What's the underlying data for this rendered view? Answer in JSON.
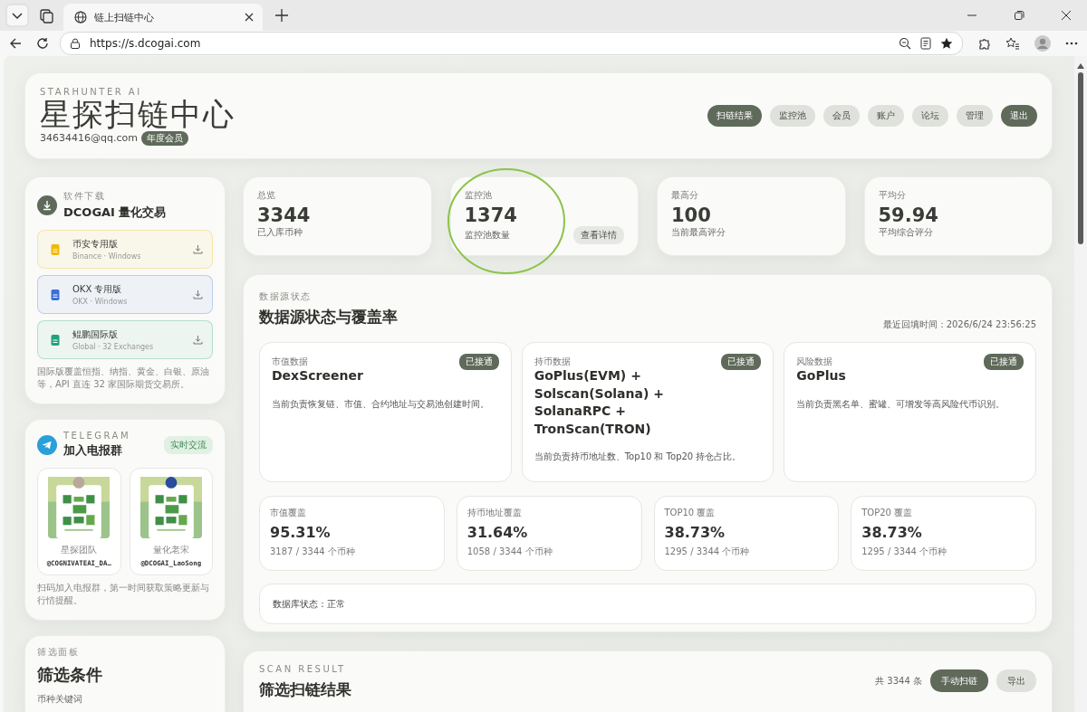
{
  "browser": {
    "tab_title": "链上扫链中心",
    "url": "https://s.dcogai.com"
  },
  "header": {
    "eyebrow": "STARHUNTER AI",
    "title": "星探扫链中心",
    "email": "34634416@qq.com",
    "badge": "年度会员",
    "nav": [
      {
        "label": "扫链结果",
        "selected": true
      },
      {
        "label": "监控池",
        "selected": false
      },
      {
        "label": "会员",
        "selected": false
      },
      {
        "label": "账户",
        "selected": false
      },
      {
        "label": "论坛",
        "selected": false
      },
      {
        "label": "管理",
        "selected": false
      }
    ],
    "logout": "退出"
  },
  "download": {
    "eyebrow": "软件下载",
    "title": "DCOGAI 量化交易",
    "items": [
      {
        "name": "币安专用版",
        "sub": "Binance · Windows",
        "color": "#f0b90b"
      },
      {
        "name": "OKX 专用版",
        "sub": "OKX · Windows",
        "color": "#3b6fd8"
      },
      {
        "name": "鲲鹏国际版",
        "sub": "Global · 32 Exchanges",
        "color": "#1fa37a"
      }
    ],
    "note": "国际版覆盖恒指、纳指、黄金、白银、原油等，API 直连 32 家国际期货交易所。"
  },
  "telegram": {
    "eyebrow": "TELEGRAM",
    "title": "加入电报群",
    "tag": "实时交流",
    "groups": [
      {
        "kind": "picture",
        "label": "星探团队",
        "handle": "@COGNIVATEAI_DA…"
      },
      {
        "kind": "picture",
        "label": "量化老宋",
        "handle": "@DCOGAI_LaoSong"
      }
    ],
    "note": "扫码加入电报群，第一时间获取策略更新与行情提醒。"
  },
  "filter": {
    "eyebrow": "筛选面板",
    "title": "筛选条件",
    "field_label": "币种关键词"
  },
  "stats": [
    {
      "label": "总览",
      "value": "3344",
      "sub": "已入库币种"
    },
    {
      "label": "监控池",
      "value": "1374",
      "sub": "监控池数量",
      "action": "查看详情"
    },
    {
      "label": "最高分",
      "value": "100",
      "sub": "当前最高评分"
    },
    {
      "label": "平均分",
      "value": "59.94",
      "sub": "平均综合评分"
    }
  ],
  "annotation": {
    "kind": "circle"
  },
  "sources": {
    "eyebrow": "数据源状态",
    "title": "数据源状态与覆盖率",
    "updated": "最近回填时间：2026/6/24 23:56:25",
    "providers": [
      {
        "label": "市值数据",
        "name": "DexScreener",
        "status": "已接通",
        "desc": "当前负责恢复链、市值、合约地址与交易池创建时间。"
      },
      {
        "label": "持币数据",
        "name": "GoPlus(EVM) + Solscan(Solana) + SolanaRPC + TronScan(TRON)",
        "status": "已接通",
        "desc": "当前负责持币地址数、Top10 和 Top20 持仓占比。"
      },
      {
        "label": "风险数据",
        "name": "GoPlus",
        "status": "已接通",
        "desc": "当前负责黑名单、蜜罐、可增发等高风险代币识别。"
      }
    ],
    "coverage": [
      {
        "label": "市值覆盖",
        "value": "95.31%",
        "sub": "3187 / 3344 个币种"
      },
      {
        "label": "持币地址覆盖",
        "value": "31.64%",
        "sub": "1058 / 3344 个币种"
      },
      {
        "label": "TOP10 覆盖",
        "value": "38.73%",
        "sub": "1295 / 3344 个币种"
      },
      {
        "label": "TOP20 覆盖",
        "value": "38.73%",
        "sub": "1295 / 3344 个币种"
      }
    ],
    "db_status": "数据库状态：正常"
  },
  "scan": {
    "eyebrow": "SCAN RESULT",
    "title": "筛选扫链结果",
    "count": "共 3344 条",
    "buttons": [
      {
        "label": "手动扫链",
        "kind": "primary"
      },
      {
        "label": "导出",
        "kind": "secondary"
      }
    ]
  }
}
